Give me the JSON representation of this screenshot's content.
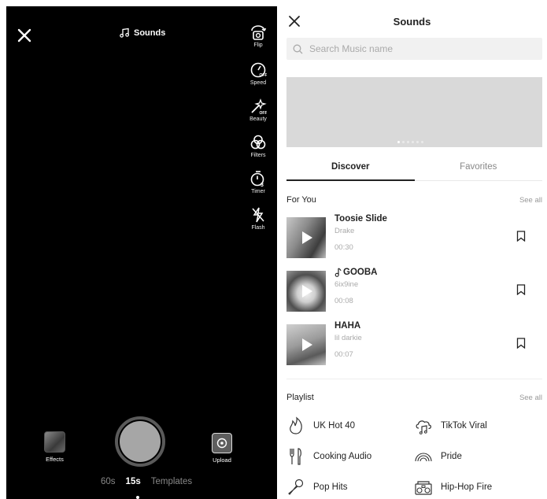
{
  "camera": {
    "sounds_label": "Sounds",
    "tools": [
      {
        "icon": "flip-icon",
        "label": "Flip"
      },
      {
        "icon": "speed-icon",
        "label": "Speed"
      },
      {
        "icon": "beauty-icon",
        "label": "Beauty"
      },
      {
        "icon": "filters-icon",
        "label": "Filters"
      },
      {
        "icon": "timer-icon",
        "label": "Timer"
      },
      {
        "icon": "flash-icon",
        "label": "Flash"
      }
    ],
    "effects_label": "Effects",
    "upload_label": "Upload",
    "durations": [
      "60s",
      "15s",
      "Templates"
    ],
    "active_duration": "15s"
  },
  "panel": {
    "title": "Sounds",
    "search_placeholder": "Search Music name",
    "tabs": [
      "Discover",
      "Favorites"
    ],
    "active_tab": "Discover",
    "for_you": {
      "title": "For You",
      "see_all": "See all",
      "songs": [
        {
          "title": "Toosie Slide",
          "artist": "Drake",
          "duration": "00:30",
          "note_icon": false
        },
        {
          "title": "GOOBA",
          "artist": "6ix9ine",
          "duration": "00:08",
          "note_icon": true
        },
        {
          "title": "HAHA",
          "artist": "lil darkie",
          "duration": "00:07",
          "note_icon": false
        }
      ]
    },
    "playlist": {
      "title": "Playlist",
      "see_all": "See all",
      "items": [
        {
          "label": "UK Hot 40",
          "icon": "fire-icon"
        },
        {
          "label": "TikTok Viral",
          "icon": "cloud-music-icon"
        },
        {
          "label": "Cooking Audio",
          "icon": "utensils-icon"
        },
        {
          "label": "Pride",
          "icon": "rainbow-icon"
        },
        {
          "label": "Pop Hits",
          "icon": "microphone-icon"
        },
        {
          "label": "Hip-Hop Fire",
          "icon": "boombox-icon"
        }
      ]
    }
  }
}
